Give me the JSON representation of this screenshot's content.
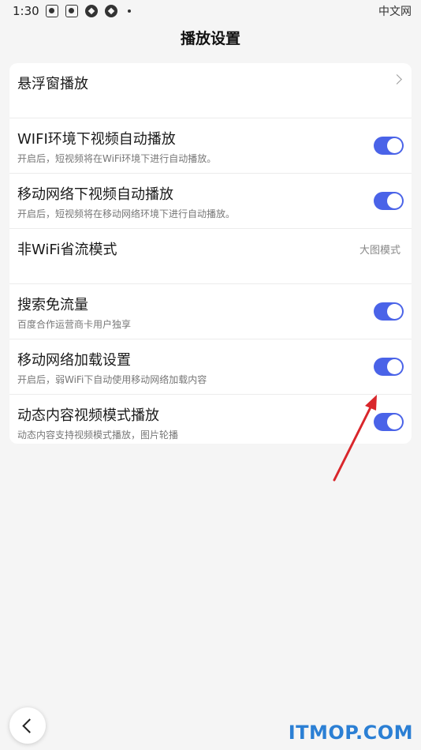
{
  "status_bar": {
    "time": "1:30",
    "icons": [
      "app-icon",
      "app-icon",
      "sync-icon",
      "sync-icon"
    ],
    "right_label": "中文网"
  },
  "header": {
    "title": "播放设置"
  },
  "settings": [
    {
      "title": "悬浮窗播放",
      "type": "link"
    },
    {
      "title": "WIFI环境下视频自动播放",
      "subtitle": "开启后，短视频将在WiFi环境下进行自动播放。",
      "type": "toggle",
      "on": true
    },
    {
      "title": "移动网络下视频自动播放",
      "subtitle": "开启后，短视频将在移动网络环境下进行自动播放。",
      "type": "toggle",
      "on": true
    },
    {
      "title": "非WiFi省流模式",
      "value": "大图模式",
      "type": "value"
    },
    {
      "title": "搜索免流量",
      "subtitle": "百度合作运营商卡用户独享",
      "type": "toggle",
      "on": true
    },
    {
      "title": "移动网络加载设置",
      "subtitle": "开启后，弱WiFi下自动使用移动网络加载内容",
      "type": "toggle",
      "on": true
    },
    {
      "title": "动态内容视频模式播放",
      "subtitle": "动态内容支持视频模式播放，图片轮播",
      "type": "toggle",
      "on": true
    }
  ],
  "colors": {
    "accent": "#4a63e8",
    "annotation_arrow": "#d9262b",
    "watermark": "#2b7fd4"
  },
  "watermark": "ITMOP.COM"
}
